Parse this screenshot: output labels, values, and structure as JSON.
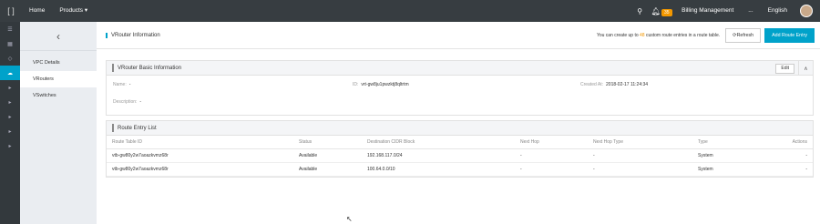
{
  "topbar": {
    "home": "Home",
    "products": "Products",
    "notification_count": "35",
    "billing": "Billing Management",
    "more": "...",
    "language": "English"
  },
  "rail": {
    "items": [
      "menu-icon",
      "grid-icon",
      "cloud-icon",
      "chevron-right-icon",
      "chevron-right-icon",
      "chevron-right-icon",
      "chevron-right-icon"
    ]
  },
  "subnav": {
    "back_label": "‹",
    "items": [
      "VPC Details",
      "VRouters",
      "VSwitches"
    ]
  },
  "header": {
    "title": "VRouter Information",
    "notice_prefix": "You can create up to ",
    "notice_num": "48",
    "notice_suffix": " custom route entries in a route table.",
    "refresh_label": "Refresh",
    "add_label": "Add Route Entry"
  },
  "basic": {
    "title": "VRouter Basic Information",
    "edit_label": "Edit",
    "name_label": "Name:",
    "name_value": "-",
    "id_label": "ID:",
    "id_value": "vrt-gw8ju1pwzktj8qltrtm",
    "created_label": "Created At:",
    "created_value": "2018-02-17 11:24:34",
    "desc_label": "Description:",
    "desc_value": "-"
  },
  "routes": {
    "title": "Route Entry List",
    "columns": [
      "Route Table ID",
      "Status",
      "Destination CIDR Block",
      "Next Hop",
      "Next Hop Type",
      "Type",
      "Actions"
    ],
    "rows": [
      [
        "vtb-gw80y2w7aoazkvmz68r",
        "Available",
        "192.168.117.0/24",
        "-",
        "-",
        "System",
        "-"
      ],
      [
        "vtb-gw80y2w7aoazkvmz68r",
        "Available",
        "100.64.0.0/10",
        "-",
        "-",
        "System",
        "-"
      ]
    ]
  }
}
